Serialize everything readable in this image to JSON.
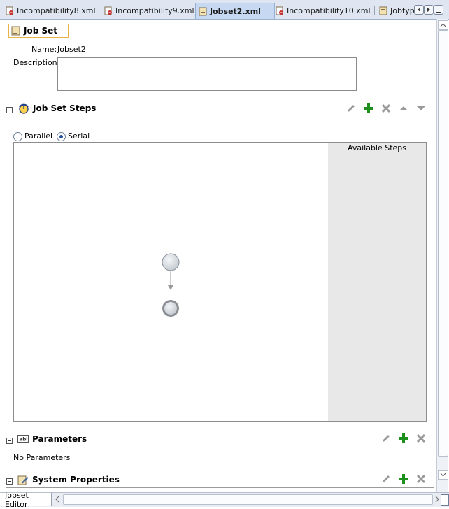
{
  "tabs": [
    {
      "label": "Incompatibility8.xml",
      "active": false
    },
    {
      "label": "Incompatibility9.xml",
      "active": false
    },
    {
      "label": "Jobset2.xml",
      "active": true
    },
    {
      "label": "Incompatibility10.xml",
      "active": false
    },
    {
      "label": "Jobtyp",
      "active": false
    }
  ],
  "header": {
    "title": "Job Set"
  },
  "form": {
    "name_label": "Name:",
    "name_value": "Jobset2",
    "description_label": "Description:",
    "description_value": ""
  },
  "steps_section": {
    "title": "Job Set Steps",
    "mode_parallel": "Parallel",
    "mode_serial": "Serial",
    "selected_mode": "Serial",
    "available_steps_label": "Available Steps"
  },
  "parameters_section": {
    "title": "Parameters",
    "empty_text": "No Parameters"
  },
  "system_properties_section": {
    "title": "System Properties"
  },
  "bottom_tabs": {
    "editor_tab": "Jobset Editor"
  },
  "colors": {
    "accent": "#24519c",
    "add_green": "#1d8f1d",
    "header_border": "#e8b34a"
  },
  "icons": [
    "file-xml-icon",
    "jobset-icon",
    "edit-icon",
    "add-icon",
    "delete-icon",
    "move-up-icon",
    "move-down-icon",
    "parameters-icon",
    "properties-icon"
  ]
}
